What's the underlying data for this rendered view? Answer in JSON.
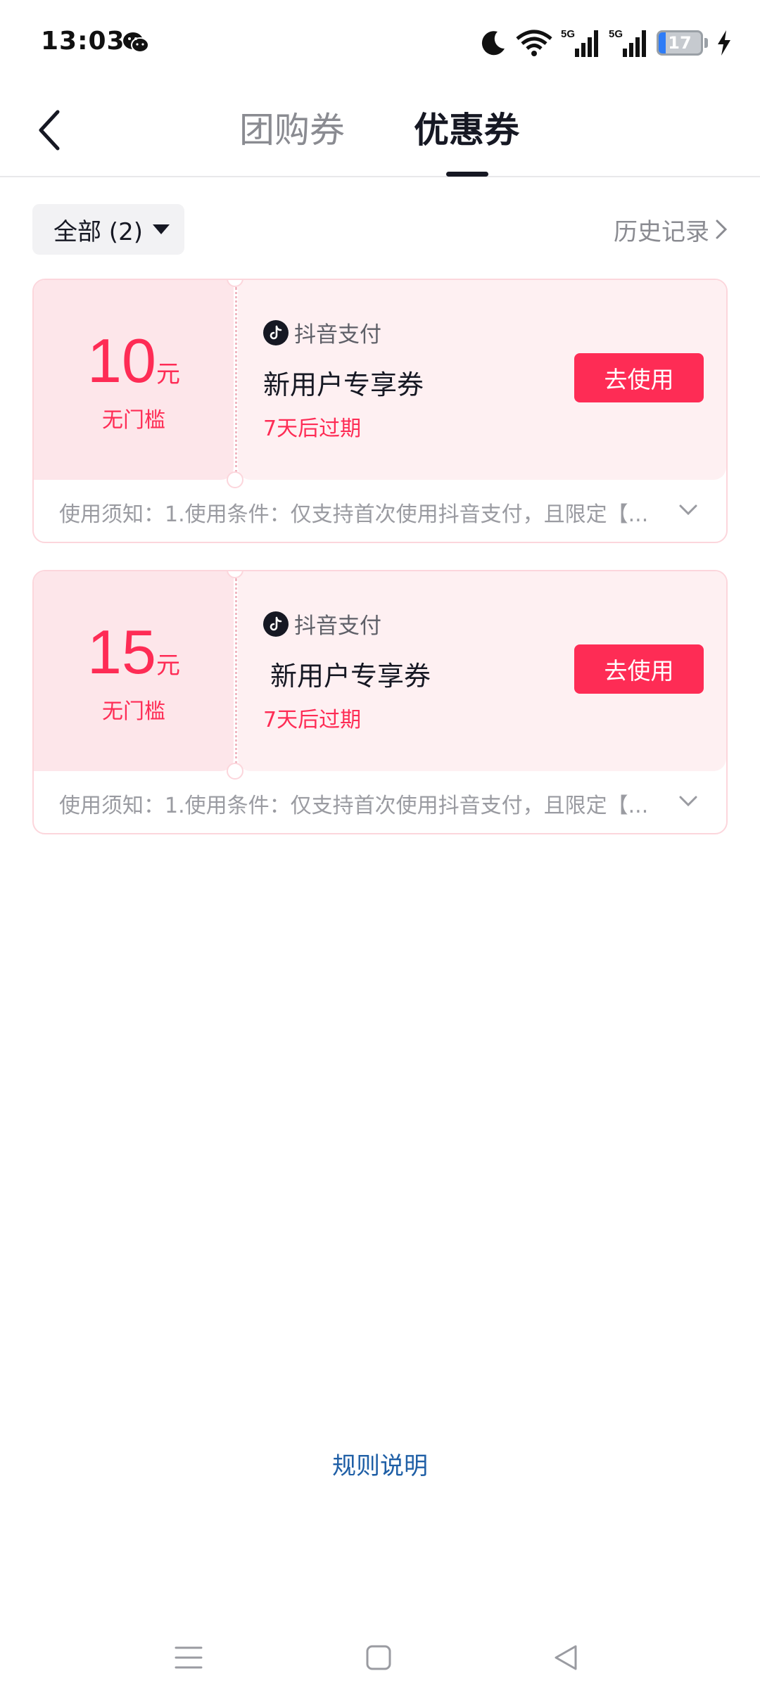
{
  "status_bar": {
    "time": "13:03",
    "battery_level": "17",
    "network_1": "5G",
    "network_2": "5G"
  },
  "header": {
    "tabs": [
      {
        "label": "团购券",
        "active": false
      },
      {
        "label": "优惠券",
        "active": true
      }
    ]
  },
  "filter": {
    "label": "全部 (2)",
    "history_label": "历史记录"
  },
  "coupons": [
    {
      "amount": "10",
      "unit": "元",
      "threshold": "无门槛",
      "brand": "抖音支付",
      "title": "新用户专享券",
      "expiry": "7天后过期",
      "button": "去使用",
      "notice": "使用须知：1.使用条件：仅支持首次使用抖音支付，且限定【..."
    },
    {
      "amount": "15",
      "unit": "元",
      "threshold": "无门槛",
      "brand": "抖音支付",
      "title": "新用户专享券",
      "expiry": "7天后过期",
      "button": "去使用",
      "notice": "使用须知：1.使用条件：仅支持首次使用抖音支付，且限定【..."
    }
  ],
  "footer": {
    "rules_label": "规则说明"
  },
  "colors": {
    "accent": "#fe2c55",
    "link": "#1f5fa6",
    "card_bg": "#fef0f2"
  }
}
